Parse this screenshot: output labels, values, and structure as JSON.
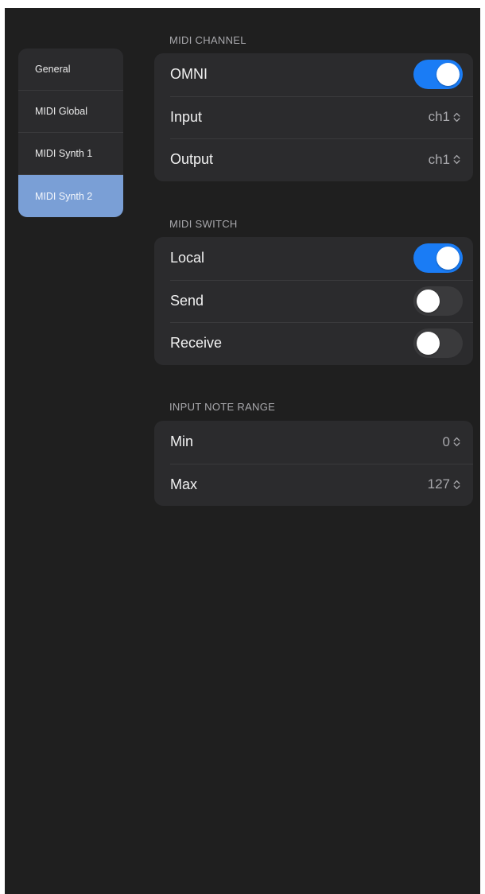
{
  "sidebar": {
    "items": [
      {
        "label": "General",
        "selected": false
      },
      {
        "label": "MIDI Global",
        "selected": false
      },
      {
        "label": "MIDI Synth 1",
        "selected": false
      },
      {
        "label": "MIDI Synth 2",
        "selected": true
      }
    ]
  },
  "midi_channel": {
    "header": "MIDI CHANNEL",
    "omni": {
      "label": "OMNI",
      "on": true
    },
    "input": {
      "label": "Input",
      "value": "ch1"
    },
    "output": {
      "label": "Output",
      "value": "ch1"
    }
  },
  "midi_switch": {
    "header": "MIDI SWITCH",
    "local": {
      "label": "Local",
      "on": true
    },
    "send": {
      "label": "Send",
      "on": false
    },
    "receive": {
      "label": "Receive",
      "on": false
    }
  },
  "input_note_range": {
    "header": "INPUT NOTE RANGE",
    "min": {
      "label": "Min",
      "value": "0"
    },
    "max": {
      "label": "Max",
      "value": "127"
    }
  },
  "colors": {
    "background": "#1f1f1f",
    "card": "#2b2b2d",
    "selected_sidebar": "#7a9fd6",
    "toggle_on": "#1a7cf5",
    "toggle_off": "#3a3a3c",
    "secondary_text": "#a9a9ad"
  },
  "icons": {
    "stepper": "chevron-up-down-icon"
  }
}
